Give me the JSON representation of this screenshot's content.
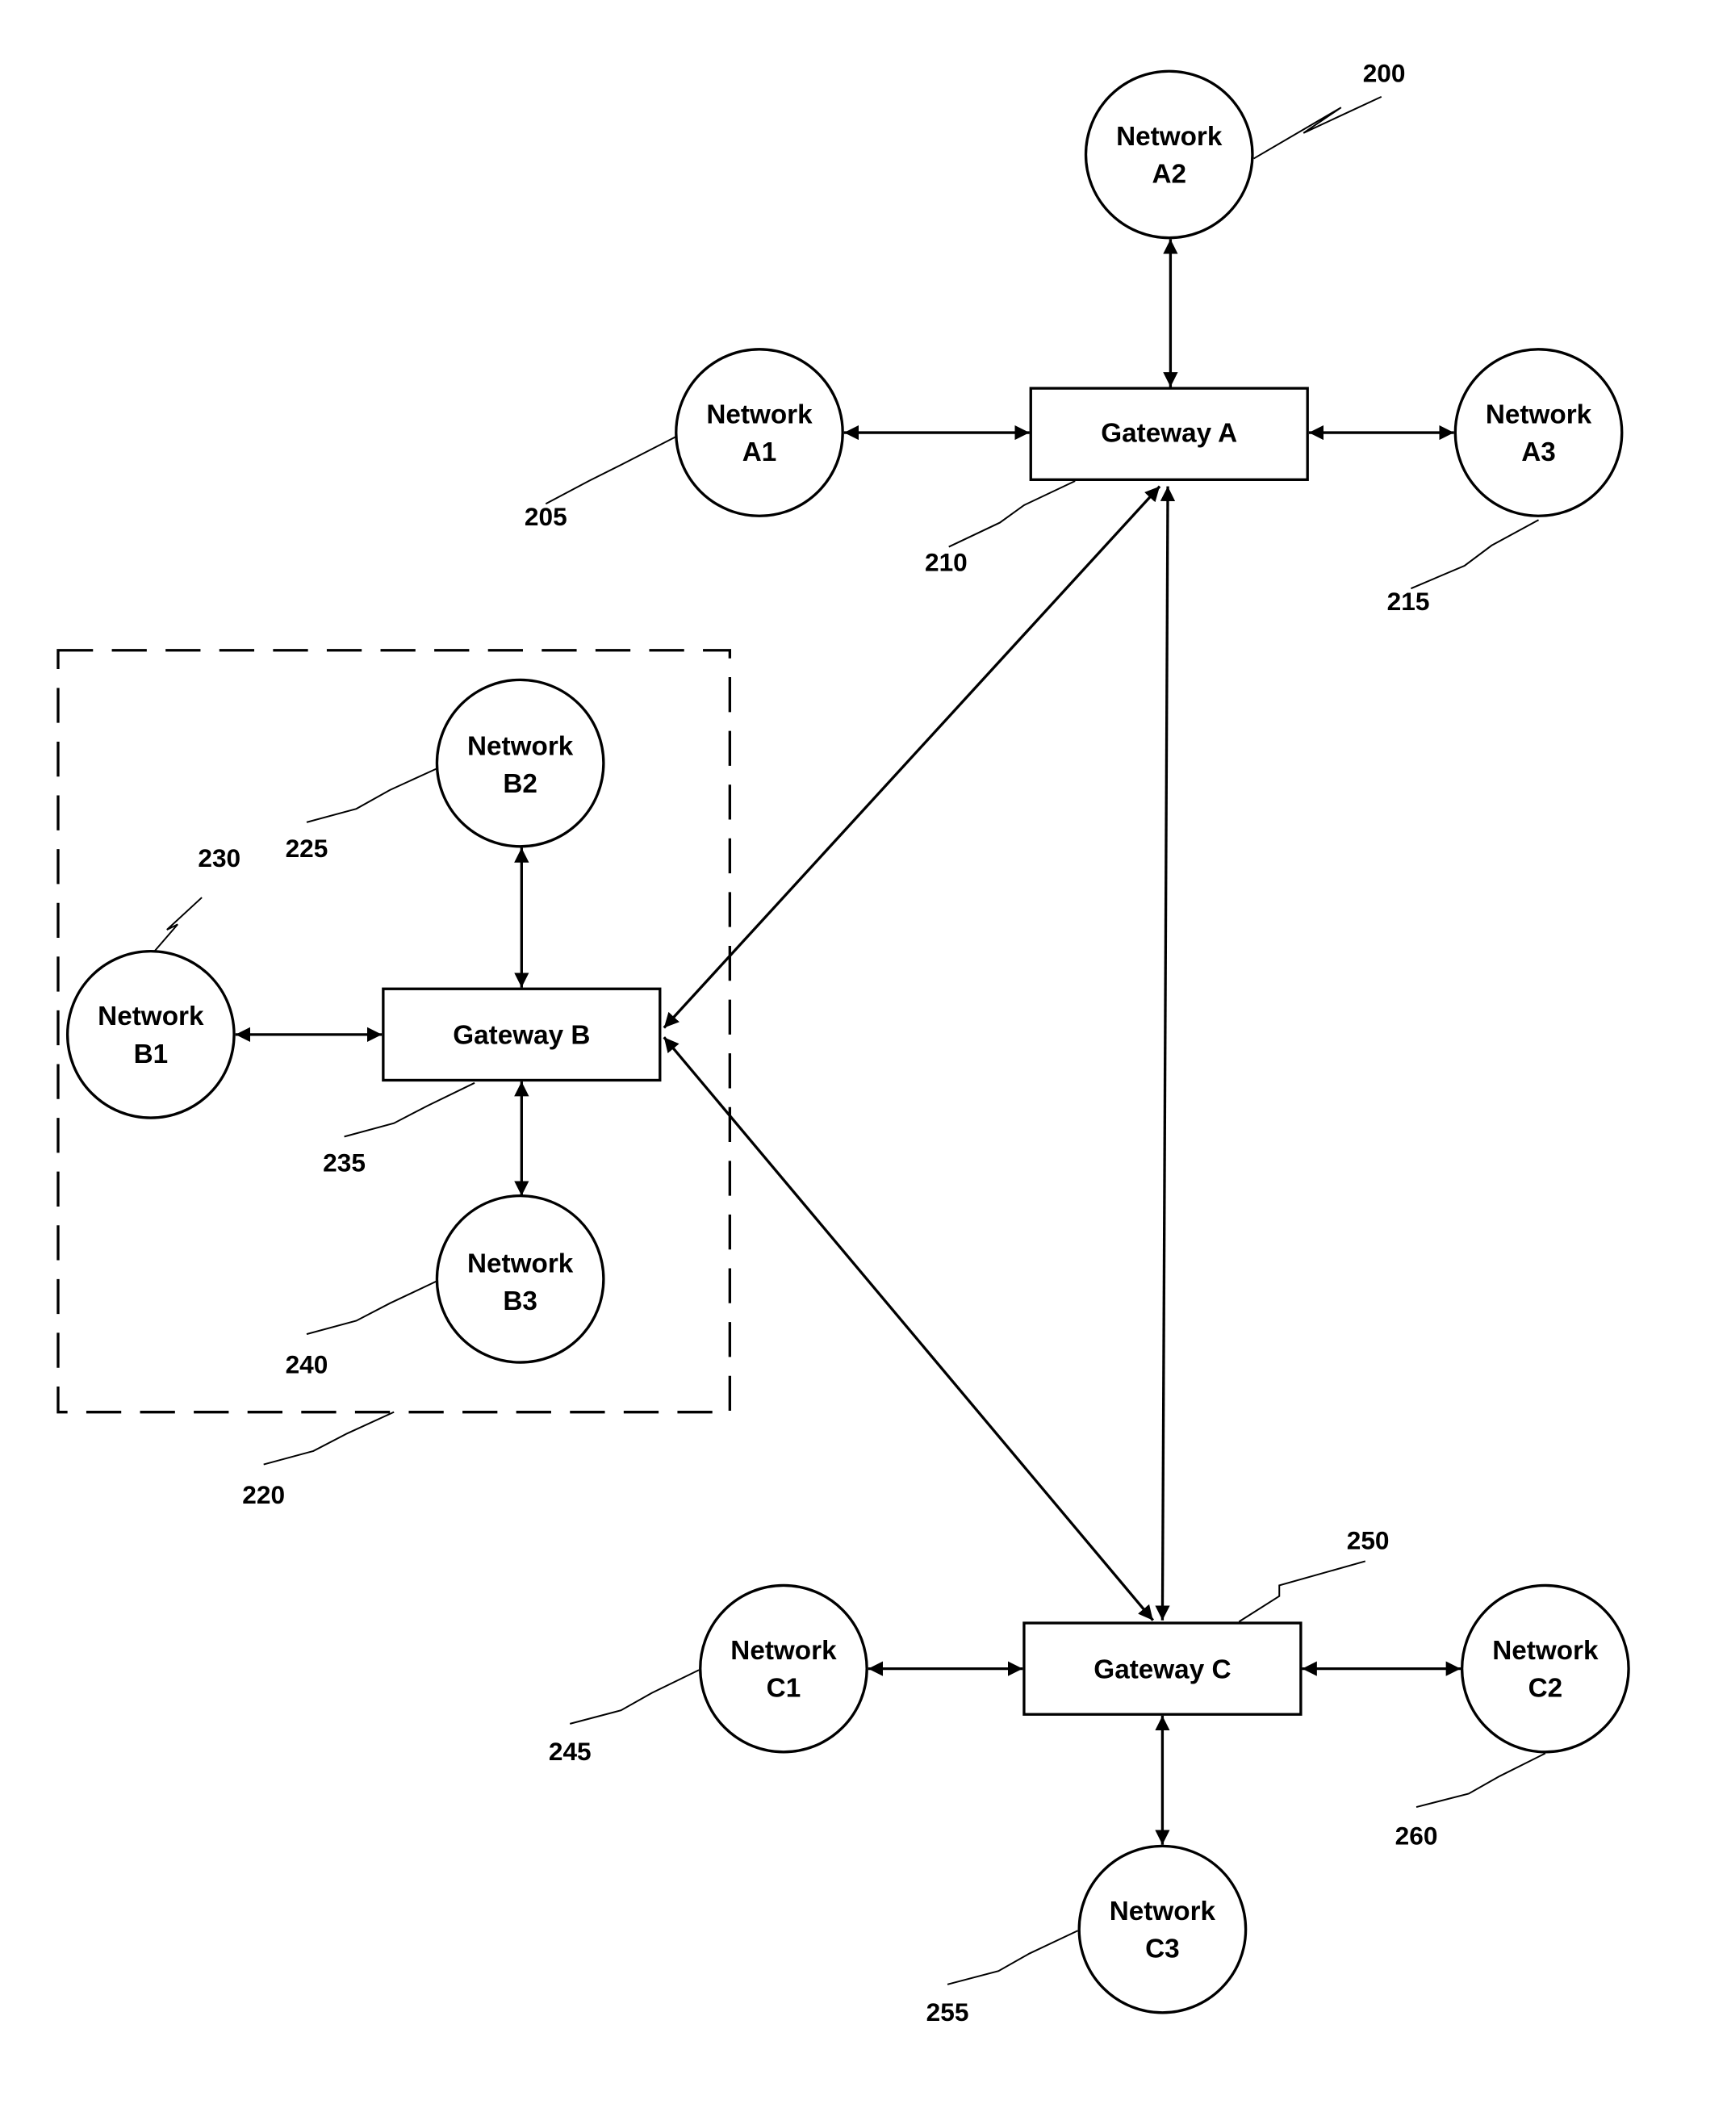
{
  "figure": {
    "group_box_ref": "220",
    "gateways": [
      {
        "id": "A",
        "label": "Gateway A",
        "ref": "210"
      },
      {
        "id": "B",
        "label": "Gateway B",
        "ref": "235"
      },
      {
        "id": "C",
        "label": "Gateway C",
        "ref": "250"
      }
    ],
    "networks": [
      {
        "id": "A1",
        "line1": "Network",
        "line2": "A1",
        "ref": "205",
        "gateway": "A"
      },
      {
        "id": "A2",
        "line1": "Network",
        "line2": "A2",
        "ref": "200",
        "gateway": "A"
      },
      {
        "id": "A3",
        "line1": "Network",
        "line2": "A3",
        "ref": "215",
        "gateway": "A"
      },
      {
        "id": "B1",
        "line1": "Network",
        "line2": "B1",
        "ref": "230",
        "gateway": "B"
      },
      {
        "id": "B2",
        "line1": "Network",
        "line2": "B2",
        "ref": "225",
        "gateway": "B"
      },
      {
        "id": "B3",
        "line1": "Network",
        "line2": "B3",
        "ref": "240",
        "gateway": "B"
      },
      {
        "id": "C1",
        "line1": "Network",
        "line2": "C1",
        "ref": "245",
        "gateway": "C"
      },
      {
        "id": "C2",
        "line1": "Network",
        "line2": "C2",
        "ref": "260",
        "gateway": "C"
      },
      {
        "id": "C3",
        "line1": "Network",
        "line2": "C3",
        "ref": "255",
        "gateway": "C"
      }
    ],
    "links": [
      {
        "from": "A1",
        "to": "A",
        "bidirectional": true
      },
      {
        "from": "A2",
        "to": "A",
        "bidirectional": true
      },
      {
        "from": "A3",
        "to": "A",
        "bidirectional": true
      },
      {
        "from": "B1",
        "to": "B",
        "bidirectional": true
      },
      {
        "from": "B2",
        "to": "B",
        "bidirectional": true
      },
      {
        "from": "B3",
        "to": "B",
        "bidirectional": true
      },
      {
        "from": "C1",
        "to": "C",
        "bidirectional": true
      },
      {
        "from": "C2",
        "to": "C",
        "bidirectional": true
      },
      {
        "from": "C3",
        "to": "C",
        "bidirectional": true
      },
      {
        "from": "A",
        "to": "B",
        "bidirectional": true
      },
      {
        "from": "A",
        "to": "C",
        "bidirectional": true
      },
      {
        "from": "B",
        "to": "C",
        "bidirectional": true
      }
    ]
  }
}
